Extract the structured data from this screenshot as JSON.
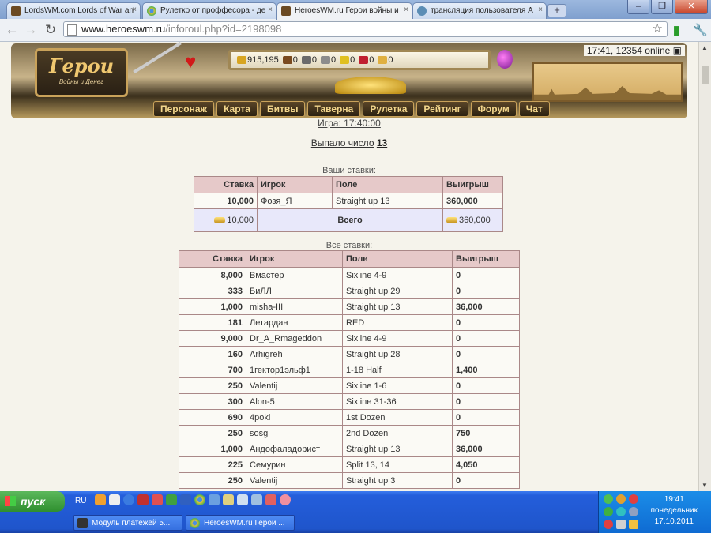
{
  "browser": {
    "tabs": [
      {
        "title": "LordsWM.com Lords of War an",
        "icon": "game-icon"
      },
      {
        "title": "Рулетко от проффесора - де",
        "icon": "chrome-icon"
      },
      {
        "title": "HeroesWM.ru Герои войны и",
        "icon": "game-icon"
      },
      {
        "title": "трансляция пользователя A",
        "icon": "network-icon"
      }
    ],
    "url_host": "www.heroeswm.ru",
    "url_path": "/inforoul.php?id=2198098"
  },
  "header": {
    "logo_title": "Герои",
    "logo_subtitle": "Войны и Денег",
    "resources": [
      {
        "name": "gold",
        "value": "915,195",
        "color": "#d8a520"
      },
      {
        "name": "wood",
        "value": "0",
        "color": "#7a4a1e"
      },
      {
        "name": "ore",
        "value": "0",
        "color": "#6b6b6b"
      },
      {
        "name": "mercury",
        "value": "0",
        "color": "#8c8c8c"
      },
      {
        "name": "sulfur",
        "value": "0",
        "color": "#e0c020"
      },
      {
        "name": "crystals",
        "value": "0",
        "color": "#c02030"
      },
      {
        "name": "gems",
        "value": "0",
        "color": "#e0b040"
      }
    ],
    "time_online": "17:41, 12354 online",
    "menu": [
      "Персонаж",
      "Карта",
      "Битвы",
      "Таверна",
      "Рулетка",
      "Рейтинг",
      "Форум",
      "Чат"
    ]
  },
  "game_link": "Игра: 17:40:00",
  "result_label": "Выпало число",
  "result_number": "13",
  "your_bets": {
    "caption": "Ваши ставки:",
    "headers": [
      "Ставка",
      "Игрок",
      "Поле",
      "Выигрыш"
    ],
    "rows": [
      [
        "10,000",
        "Фозя_Я",
        "Straight up 13",
        "360,000"
      ]
    ],
    "total_bet": "10,000",
    "total_label": "Всего",
    "total_win": "360,000"
  },
  "all_bets": {
    "caption": "Все ставки:",
    "headers": [
      "Ставка",
      "Игрок",
      "Поле",
      "Выигрыш"
    ],
    "rows": [
      [
        "8,000",
        "Вмастер",
        "Sixline 4-9",
        "0"
      ],
      [
        "333",
        "БиЛЛ",
        "Straight up 29",
        "0"
      ],
      [
        "1,000",
        "misha-III",
        "Straight up 13",
        "36,000"
      ],
      [
        "181",
        "Летардан",
        "RED",
        "0"
      ],
      [
        "9,000",
        "Dr_A_Rmageddon",
        "Sixline 4-9",
        "0"
      ],
      [
        "160",
        "Arhigreh",
        "Straight up 28",
        "0"
      ],
      [
        "700",
        "1гектор1эльф1",
        "1-18 Half",
        "1,400"
      ],
      [
        "250",
        "Valentij",
        "Sixline 1-6",
        "0"
      ],
      [
        "300",
        "Alon-5",
        "Sixline 31-36",
        "0"
      ],
      [
        "690",
        "4poki",
        "1st Dozen",
        "0"
      ],
      [
        "250",
        "sosg",
        "2nd Dozen",
        "750"
      ],
      [
        "1,000",
        "Андофаладорист",
        "Straight up 13",
        "36,000"
      ],
      [
        "225",
        "Семурин",
        "Split 13, 14",
        "4,050"
      ],
      [
        "250",
        "Valentij",
        "Straight up 3",
        "0"
      ]
    ]
  },
  "taskbar": {
    "start_label": "пуск",
    "language": "RU",
    "tasks": [
      "Модуль платежей 5...",
      "HeroesWM.ru Герои ..."
    ],
    "clock_time": "19:41",
    "clock_day": "понедельник",
    "clock_date": "17.10.2011"
  }
}
